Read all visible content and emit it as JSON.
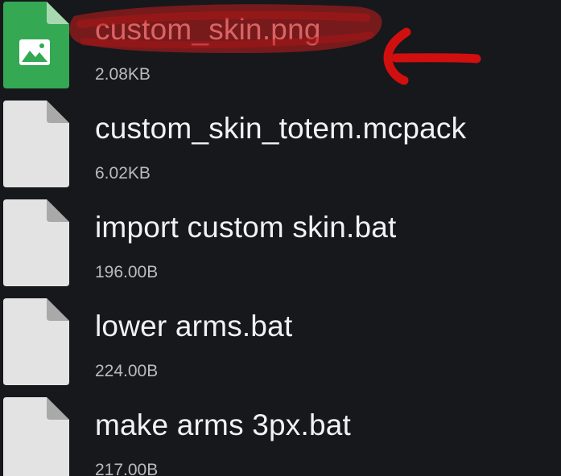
{
  "colors": {
    "background": "#16181c",
    "image_icon_green": "#34a853",
    "image_icon_fold": "#a8d8b0",
    "generic_icon_gray": "#e3e3e3",
    "generic_icon_fold": "#a9a9a9",
    "file_name_text": "#f2f2f2",
    "file_size_text": "#b9bbbe",
    "annotation_red": "#cc1111"
  },
  "files": [
    {
      "name": "custom_skin.png",
      "size": "2.08KB",
      "icon": "image-file-icon"
    },
    {
      "name": "custom_skin_totem.mcpack",
      "size": "6.02KB",
      "icon": "generic-file-icon"
    },
    {
      "name": "import custom skin.bat",
      "size": "196.00B",
      "icon": "generic-file-icon"
    },
    {
      "name": "lower arms.bat",
      "size": "224.00B",
      "icon": "generic-file-icon"
    },
    {
      "name": "make arms 3px.bat",
      "size": "217.00B",
      "icon": "generic-file-icon"
    }
  ]
}
